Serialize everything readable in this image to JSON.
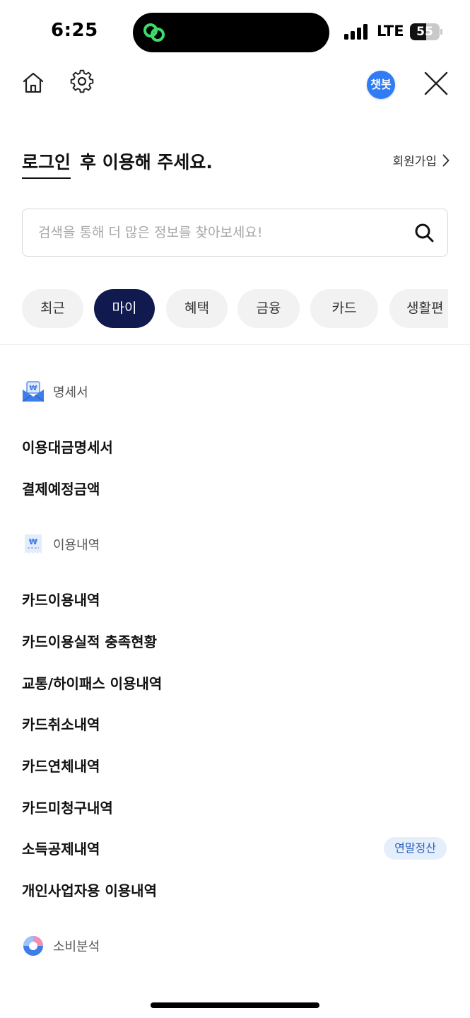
{
  "status_bar": {
    "time": "6:25",
    "network": "LTE",
    "battery_level": "55",
    "battery_fraction": 0.55
  },
  "header": {
    "chatbot_label": "챗봇"
  },
  "login": {
    "link_text": "로그인",
    "rest_text": "후 이용해 주세요.",
    "signup_label": "회원가입"
  },
  "search": {
    "placeholder": "검색을 통해 더 많은 정보를 찾아보세요!"
  },
  "tabs": [
    {
      "label": "최근",
      "active": false
    },
    {
      "label": "마이",
      "active": true
    },
    {
      "label": "혜택",
      "active": false
    },
    {
      "label": "금융",
      "active": false
    },
    {
      "label": "카드",
      "active": false
    },
    {
      "label": "생활편",
      "active": false
    }
  ],
  "sections": {
    "statement": {
      "title": "명세서",
      "icon": "statement-envelope-icon",
      "items": [
        "이용대금명세서",
        "결제예정금액"
      ]
    },
    "usage": {
      "title": "이용내역",
      "icon": "receipt-icon",
      "items": [
        "카드이용내역",
        "카드이용실적 충족현황",
        "교통/하이패스 이용내역",
        "카드취소내역",
        "카드연체내역",
        "카드미청구내역",
        "소득공제내역",
        "개인사업자용 이용내역"
      ],
      "badge": "연말정산"
    },
    "analysis": {
      "title": "소비분석",
      "icon": "donut-chart-icon"
    }
  },
  "colors": {
    "active_tab": "#101a4e",
    "chatbot": "#2f7cf6",
    "badge_bg": "#e5effc",
    "badge_text": "#2a5fbd",
    "island_icon": "#3ddc6a"
  }
}
